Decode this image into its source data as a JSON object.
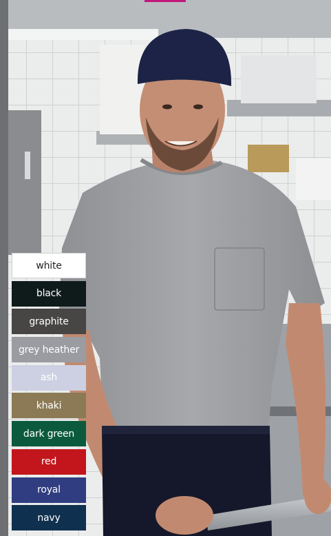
{
  "image": {
    "subject": "chef-in-kitchen",
    "wears": [
      "navy skull cap",
      "grey heather pocket t-shirt",
      "dark apron"
    ]
  },
  "colors": {
    "tiles": "#e9eaea",
    "grout": "#cfd2d2",
    "shirt": "#9d9fa3",
    "cap": "#1c2346",
    "apron": "#15182a",
    "skin": "#c48e74"
  },
  "swatches": [
    {
      "label": "white",
      "bg": "#ffffff",
      "fg": "#222222"
    },
    {
      "label": "black",
      "bg": "#0f1a1b",
      "fg": "#ffffff"
    },
    {
      "label": "graphite",
      "bg": "#474644",
      "fg": "#ffffff"
    },
    {
      "label": "grey heather",
      "bg": "#9b9ba2",
      "fg": "#ffffff"
    },
    {
      "label": "ash",
      "bg": "#cdd0e2",
      "fg": "#ffffff"
    },
    {
      "label": "khaki",
      "bg": "#8b7a55",
      "fg": "#ffffff"
    },
    {
      "label": "dark green",
      "bg": "#0b5a3d",
      "fg": "#ffffff"
    },
    {
      "label": "red",
      "bg": "#c2161c",
      "fg": "#ffffff"
    },
    {
      "label": "royal",
      "bg": "#303d80",
      "fg": "#ffffff"
    },
    {
      "label": "navy",
      "bg": "#10304f",
      "fg": "#ffffff"
    }
  ]
}
